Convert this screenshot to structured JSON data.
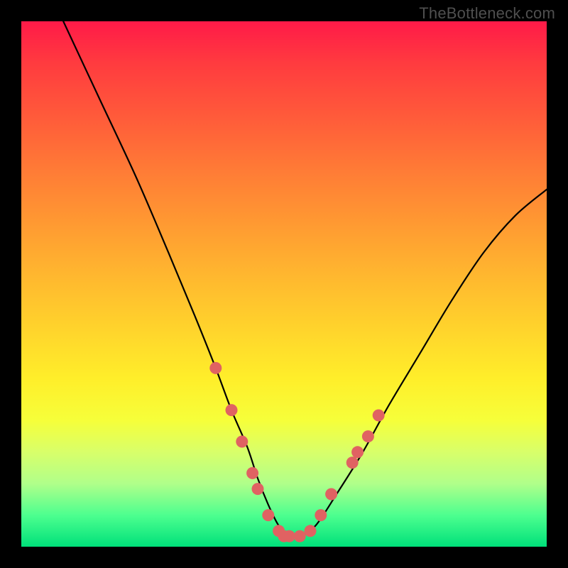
{
  "watermark": "TheBottleneck.com",
  "colors": {
    "page_bg": "#000000",
    "curve_stroke": "#000000",
    "marker_fill": "#e06262",
    "marker_stroke": "#d04848",
    "gradient_top": "#ff1a48",
    "gradient_bottom": "#00e07a"
  },
  "chart_data": {
    "type": "line",
    "title": "",
    "xlabel": "",
    "ylabel": "",
    "xlim": [
      0,
      100
    ],
    "ylim": [
      0,
      100
    ],
    "grid": false,
    "legend": null,
    "series": [
      {
        "name": "curve",
        "x": [
          8,
          15,
          22,
          28,
          33,
          37,
          40,
          43,
          45,
          47,
          49,
          51,
          53,
          56,
          60,
          65,
          70,
          76,
          82,
          88,
          94,
          100
        ],
        "y": [
          100,
          85,
          70,
          56,
          44,
          34,
          26,
          19,
          13,
          8,
          4,
          2,
          2,
          4,
          10,
          18,
          27,
          37,
          47,
          56,
          63,
          68
        ]
      }
    ],
    "markers": [
      {
        "x": 37,
        "y": 34
      },
      {
        "x": 40,
        "y": 26
      },
      {
        "x": 42,
        "y": 20
      },
      {
        "x": 44,
        "y": 14
      },
      {
        "x": 45,
        "y": 11
      },
      {
        "x": 47,
        "y": 6
      },
      {
        "x": 49,
        "y": 3
      },
      {
        "x": 50,
        "y": 2
      },
      {
        "x": 51,
        "y": 2
      },
      {
        "x": 53,
        "y": 2
      },
      {
        "x": 55,
        "y": 3
      },
      {
        "x": 57,
        "y": 6
      },
      {
        "x": 59,
        "y": 10
      },
      {
        "x": 63,
        "y": 16
      },
      {
        "x": 64,
        "y": 18
      },
      {
        "x": 66,
        "y": 21
      },
      {
        "x": 68,
        "y": 25
      }
    ]
  }
}
